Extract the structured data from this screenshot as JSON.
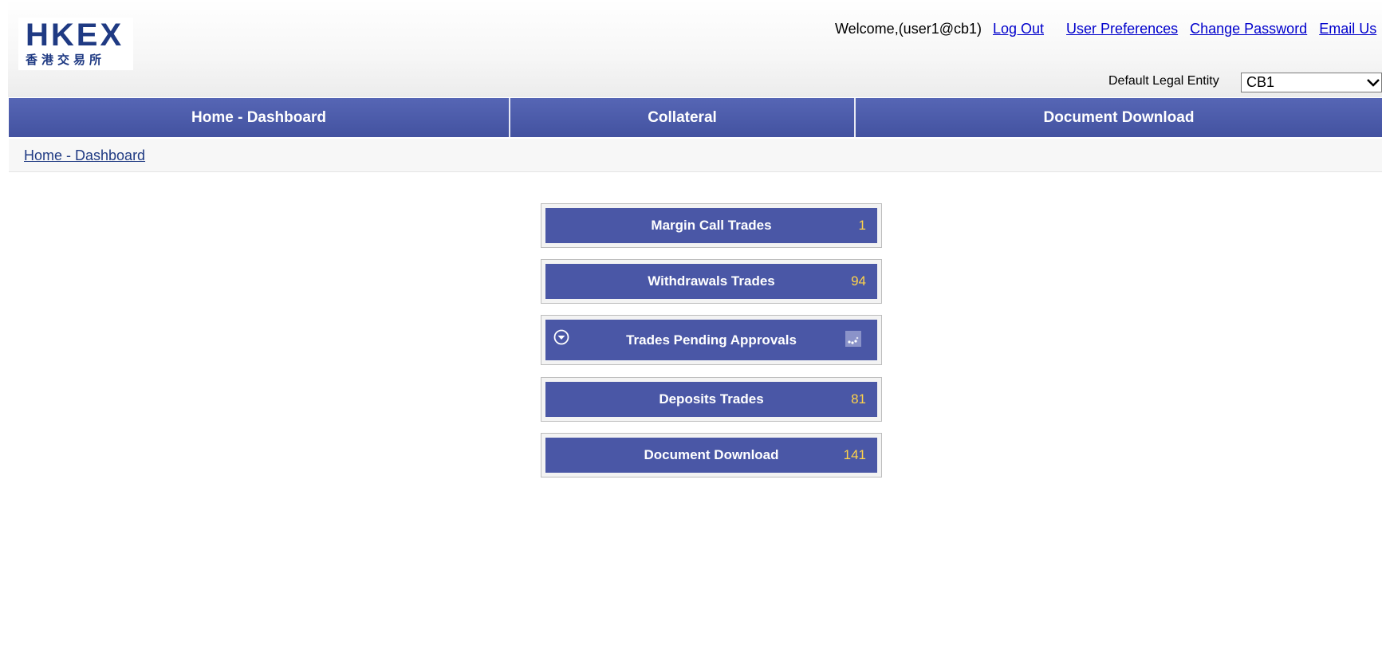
{
  "header": {
    "logo": {
      "main": "HKEX",
      "sub": "香港交易所"
    },
    "welcome": "Welcome,(user1@cb1)",
    "links": {
      "logout": "Log Out",
      "user_preferences": "User Preferences",
      "change_password": "Change Password",
      "email": "Email Us"
    },
    "default_entity": {
      "label": "Default Legal Entity",
      "value": "CB1"
    }
  },
  "nav": {
    "items": [
      {
        "label": "Home - Dashboard"
      },
      {
        "label": "Collateral"
      },
      {
        "label": "Document Download"
      }
    ]
  },
  "breadcrumb": {
    "current": "Home - Dashboard"
  },
  "tiles": [
    {
      "label": "Margin Call Trades",
      "count": "1"
    },
    {
      "label": "Withdrawals Trades",
      "count": "94"
    },
    {
      "label": "Trades Pending Approvals",
      "count": "",
      "icon": "expand-circle-icon",
      "status_icon": "loading-icon"
    },
    {
      "label": "Deposits Trades",
      "count": "81"
    },
    {
      "label": "Document Download",
      "count": "141"
    }
  ],
  "colors": {
    "brand_blue": "#1f3a83",
    "nav_blue": "#4b5aa8",
    "tile_blue": "#4a57a6",
    "count_yellow": "#ffd34a",
    "link_blue": "#0000cc"
  }
}
